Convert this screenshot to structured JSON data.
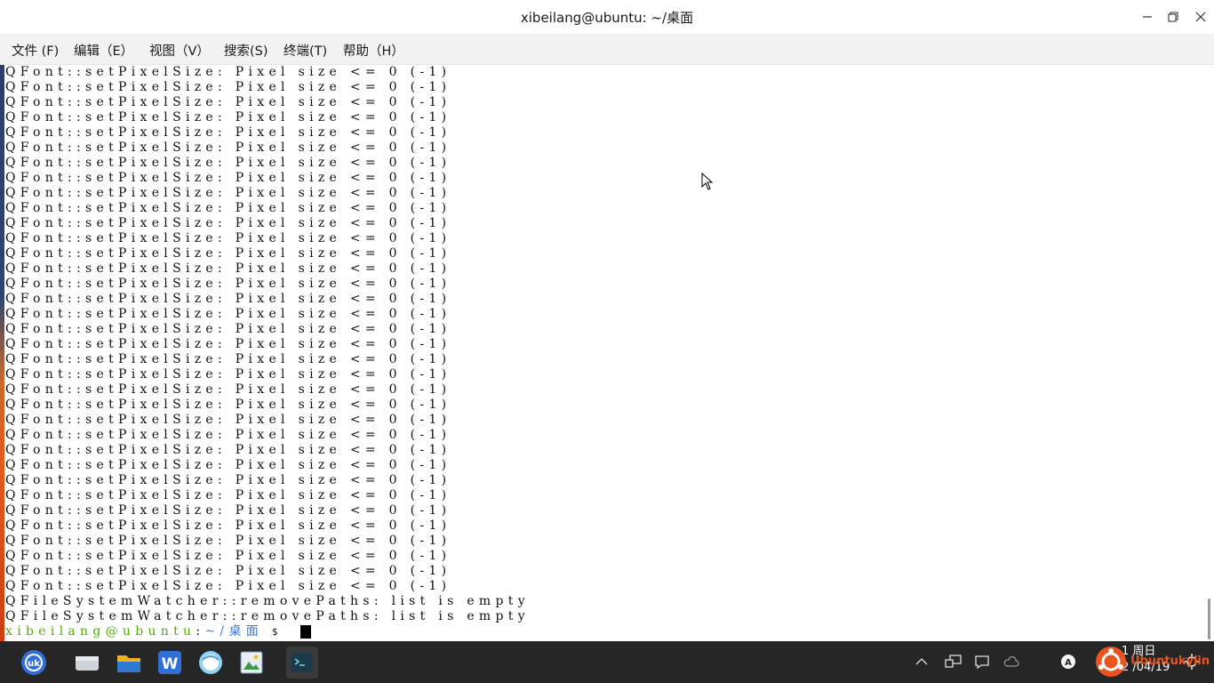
{
  "window": {
    "title": "xibeilang@ubuntu: ~/桌面"
  },
  "menu": [
    {
      "label": "文件 (F)"
    },
    {
      "label": "编辑（E）"
    },
    {
      "label": "视图（V）"
    },
    {
      "label": "搜索(S)"
    },
    {
      "label": "终端(T)"
    },
    {
      "label": "帮助（H）"
    }
  ],
  "terminal": {
    "repeat_line": "QFont::setPixelSize: Pixel size <= 0 (-1)",
    "repeat_count": 35,
    "watcher_lines": [
      "QFileSystemWatcher::removePaths: list is empty",
      "QFileSystemWatcher::removePaths: list is empty"
    ],
    "prompt_user": "xibeilang@ubuntu",
    "prompt_colon": ":",
    "prompt_path": "~/桌面",
    "prompt_symbol": "$"
  },
  "taskbar": {
    "apps": [
      "ukui-start-icon",
      "file-manager-icon",
      "folder-icon",
      "wps-writer-icon",
      "browser-icon",
      "image-viewer-icon",
      "terminal-icon"
    ],
    "tray": [
      "chevron-up-icon",
      "network-icon",
      "notification-icon",
      "cloud-icon",
      "input-method-icon",
      "settings-icon"
    ],
    "clock_line1": "1 周日",
    "clock_line2": "2 /04/19",
    "watermark": "Ubuntukylin"
  },
  "colors": {
    "prompt_user": "#4caf00",
    "prompt_path": "#3a78d6",
    "taskbar": "#262626",
    "accent": "#e9541f"
  }
}
